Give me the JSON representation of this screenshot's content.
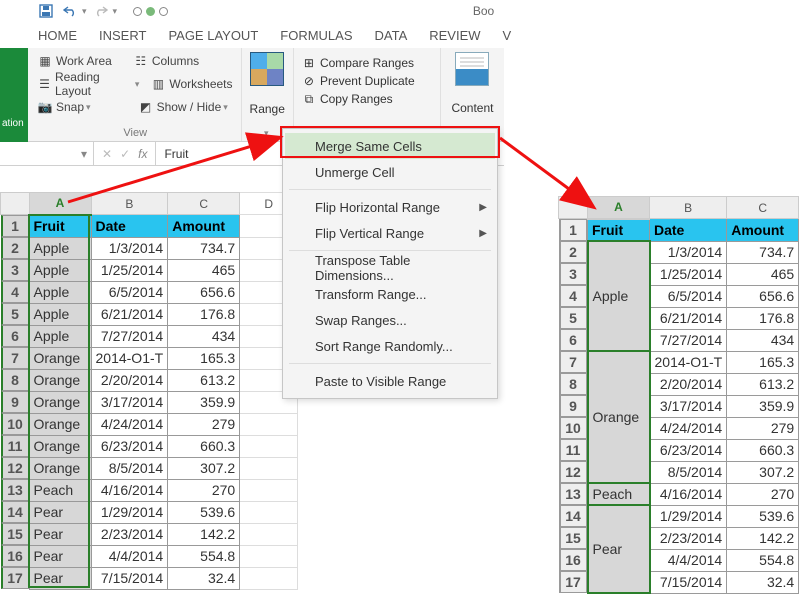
{
  "titlebar": {
    "doc_name": "Boo"
  },
  "tabs": [
    "HOME",
    "INSERT",
    "PAGE LAYOUT",
    "FORMULAS",
    "DATA",
    "REVIEW",
    "V"
  ],
  "ribbon": {
    "navigation": {
      "work_area": "Work Area",
      "reading_layout": "Reading Layout",
      "snap": "Snap",
      "columns": "Columns",
      "worksheets": "Worksheets",
      "show_hide": "Show / Hide",
      "group_label": "View"
    },
    "range_label": "Range",
    "compare": {
      "compare_ranges": "Compare Ranges",
      "prevent_duplicate": "Prevent Duplicate",
      "copy_ranges": "Copy Ranges"
    },
    "content_label": "Content"
  },
  "formula_bar": {
    "namebox": "",
    "value": "Fruit"
  },
  "dropdown": {
    "items": [
      {
        "label": "Merge Same Cells",
        "hover": true
      },
      {
        "label": "Unmerge Cell"
      },
      {
        "label": "Flip Horizontal Range",
        "submenu": true
      },
      {
        "label": "Flip Vertical Range",
        "submenu": true
      },
      {
        "label": "Transpose Table Dimensions..."
      },
      {
        "label": "Transform Range..."
      },
      {
        "label": "Swap Ranges..."
      },
      {
        "label": "Sort Range Randomly..."
      },
      {
        "label": "Paste to Visible Range"
      }
    ]
  },
  "sheet": {
    "col_letters": [
      "A",
      "B",
      "C",
      "D"
    ],
    "col_letters_right": [
      "A",
      "B",
      "C"
    ],
    "headers": {
      "fruit": "Fruit",
      "date": "Date",
      "amount": "Amount"
    },
    "rows": [
      {
        "n": 1
      },
      {
        "n": 2,
        "fruit": "Apple",
        "date": "1/3/2014",
        "amount": "734.7"
      },
      {
        "n": 3,
        "fruit": "Apple",
        "date": "1/25/2014",
        "amount": "465"
      },
      {
        "n": 4,
        "fruit": "Apple",
        "date": "6/5/2014",
        "amount": "656.6"
      },
      {
        "n": 5,
        "fruit": "Apple",
        "date": "6/21/2014",
        "amount": "176.8"
      },
      {
        "n": 6,
        "fruit": "Apple",
        "date": "7/27/2014",
        "amount": "434"
      },
      {
        "n": 7,
        "fruit": "Orange",
        "date": "2014-O1-T",
        "amount": "165.3"
      },
      {
        "n": 8,
        "fruit": "Orange",
        "date": "2/20/2014",
        "amount": "613.2"
      },
      {
        "n": 9,
        "fruit": "Orange",
        "date": "3/17/2014",
        "amount": "359.9"
      },
      {
        "n": 10,
        "fruit": "Orange",
        "date": "4/24/2014",
        "amount": "279"
      },
      {
        "n": 11,
        "fruit": "Orange",
        "date": "6/23/2014",
        "amount": "660.3"
      },
      {
        "n": 12,
        "fruit": "Orange",
        "date": "8/5/2014",
        "amount": "307.2"
      },
      {
        "n": 13,
        "fruit": "Peach",
        "date": "4/16/2014",
        "amount": "270"
      },
      {
        "n": 14,
        "fruit": "Pear",
        "date": "1/29/2014",
        "amount": "539.6"
      },
      {
        "n": 15,
        "fruit": "Pear",
        "date": "2/23/2014",
        "amount": "142.2"
      },
      {
        "n": 16,
        "fruit": "Pear",
        "date": "4/4/2014",
        "amount": "554.8"
      },
      {
        "n": 17,
        "fruit": "Pear",
        "date": "7/15/2014",
        "amount": "32.4"
      }
    ],
    "merged_right": [
      {
        "label": "Apple",
        "start": 2,
        "span": 5
      },
      {
        "label": "Orange",
        "start": 7,
        "span": 6
      },
      {
        "label": "Peach",
        "start": 13,
        "span": 1
      },
      {
        "label": "Pear",
        "start": 14,
        "span": 4
      }
    ]
  }
}
